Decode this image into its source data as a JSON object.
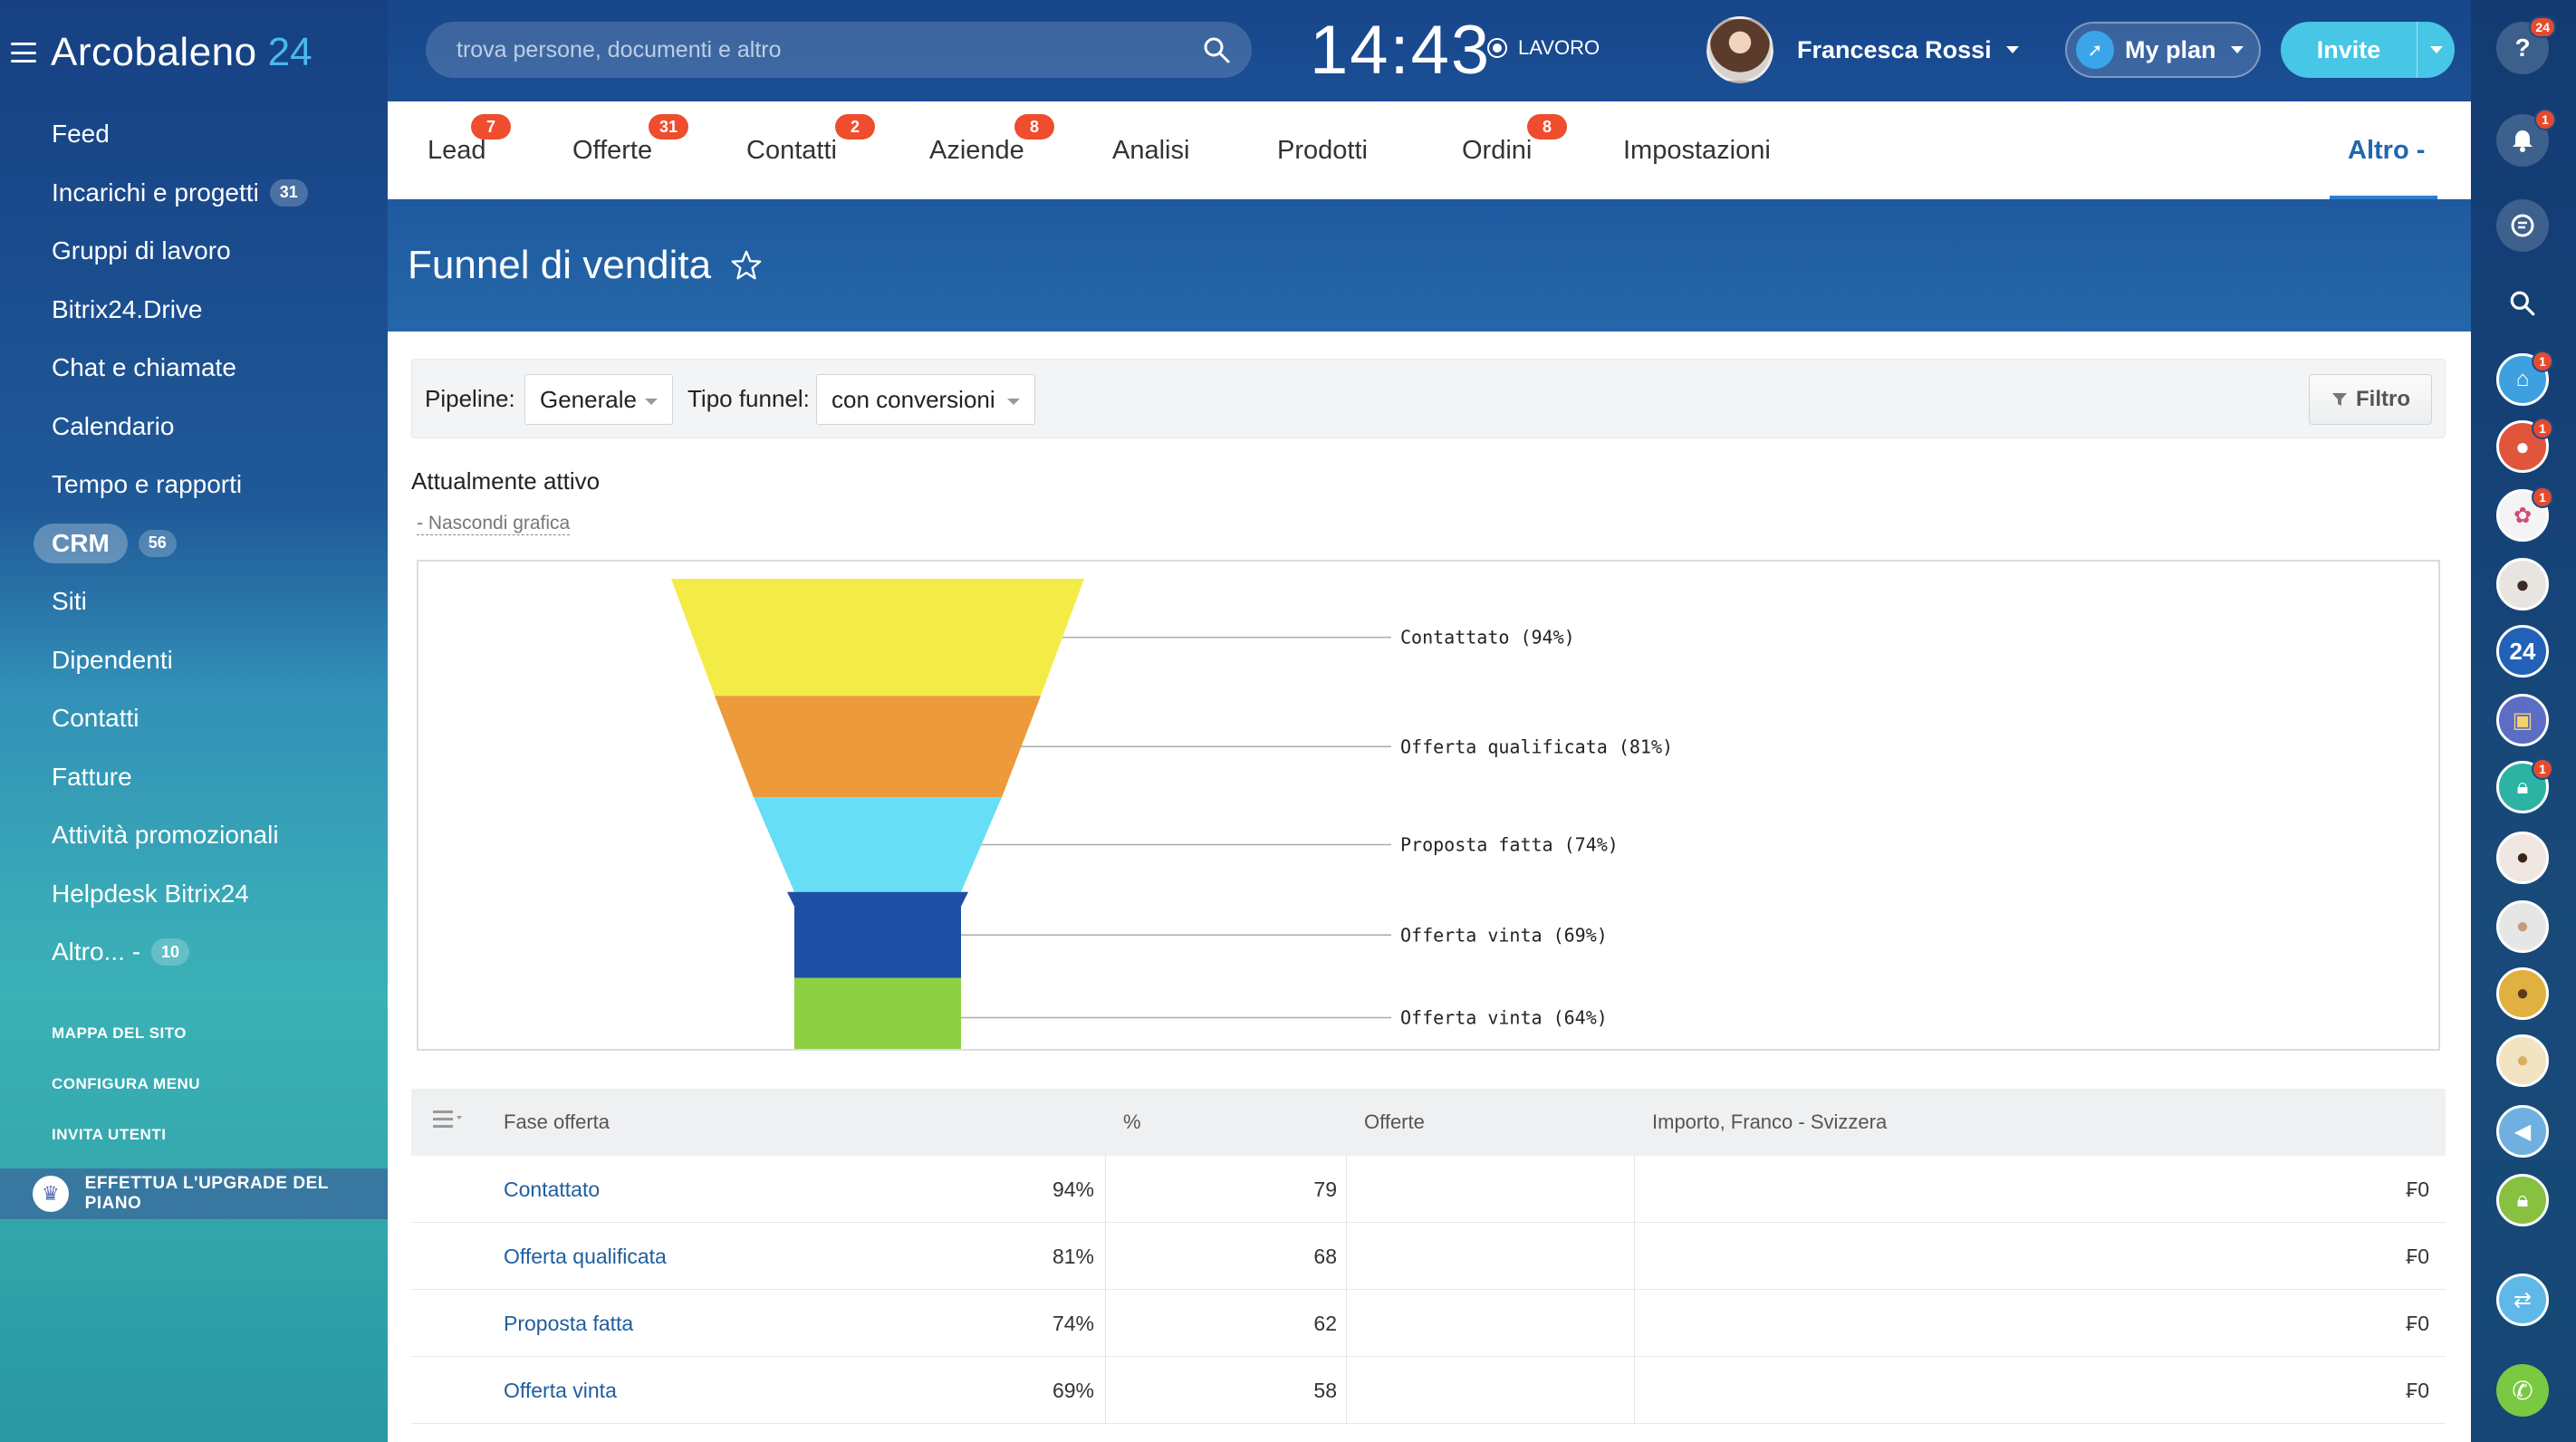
{
  "app": {
    "name": "Arcobaleno",
    "number": "24"
  },
  "sidebar": {
    "items": [
      {
        "label": "Feed",
        "count": ""
      },
      {
        "label": "Incarichi e progetti",
        "count": "31"
      },
      {
        "label": "Gruppi di lavoro",
        "count": ""
      },
      {
        "label": "Bitrix24.Drive",
        "count": ""
      },
      {
        "label": "Chat e chiamate",
        "count": ""
      },
      {
        "label": "Calendario",
        "count": ""
      },
      {
        "label": "Tempo e rapporti",
        "count": ""
      },
      {
        "label": "CRM",
        "count": "56"
      },
      {
        "label": "Siti",
        "count": ""
      },
      {
        "label": "Dipendenti",
        "count": ""
      },
      {
        "label": "Contatti",
        "count": ""
      },
      {
        "label": "Fatture",
        "count": ""
      },
      {
        "label": "Attività promozionali",
        "count": ""
      },
      {
        "label": "Helpdesk Bitrix24",
        "count": ""
      },
      {
        "label": "Altro... -",
        "count": "10"
      }
    ],
    "site_map": "MAPPA DEL SITO",
    "configure_menu": "CONFIGURA MENU",
    "invite_users": "INVITA UTENTI",
    "upgrade": "EFFETTUA L'UPGRADE DEL PIANO"
  },
  "header": {
    "search_placeholder": "trova persone, documenti e altro",
    "clock": "14:43",
    "work_status": "LAVORO",
    "user_name": "Francesca Rossi",
    "my_plan": "My plan",
    "invite": "Invite"
  },
  "rail": {
    "help_badge": "24",
    "notif_badge": "1",
    "apps_badge_1": "1",
    "apps_badge_2": "1",
    "apps_badge_3": "1",
    "apps_badge_4": "1",
    "brand_24": "24"
  },
  "tabs": [
    {
      "label": "Lead",
      "badge": "7"
    },
    {
      "label": "Offerte",
      "badge": "31"
    },
    {
      "label": "Contatti",
      "badge": "2"
    },
    {
      "label": "Aziende",
      "badge": "8"
    },
    {
      "label": "Analisi",
      "badge": ""
    },
    {
      "label": "Prodotti",
      "badge": ""
    },
    {
      "label": "Ordini",
      "badge": "8"
    },
    {
      "label": "Impostazioni",
      "badge": ""
    },
    {
      "label": "Altro -",
      "badge": ""
    }
  ],
  "page": {
    "title": "Funnel di vendita",
    "pipeline_label": "Pipeline:",
    "pipeline_value": "Generale",
    "funnel_type_label": "Tipo funnel:",
    "funnel_type_value": "con conversioni",
    "filter_button": "Filtro",
    "active_label": "Attualmente attivo",
    "hide_chart": "- Nascondi grafica"
  },
  "chart_data": {
    "type": "funnel",
    "stages": [
      {
        "label": "Contattato (94%)",
        "value": 94,
        "color": "#f4ec46"
      },
      {
        "label": "Offerta qualificata (81%)",
        "value": 81,
        "color": "#ec9a3a"
      },
      {
        "label": "Proposta fatta (74%)",
        "value": 74,
        "color": "#66def6"
      },
      {
        "label": "Offerta vinta (69%)",
        "value": 69,
        "color": "#1f4fa5"
      },
      {
        "label": "Offerta vinta (64%)",
        "value": 64,
        "color": "#8dd142"
      }
    ]
  },
  "table": {
    "headers": [
      "Fase offerta",
      "%",
      "Offerte",
      "Importo, Franco - Svizzera"
    ],
    "rows": [
      {
        "stage": "Contattato",
        "pct": "94%",
        "deals": "79",
        "amount": "₣0"
      },
      {
        "stage": "Offerta qualificata",
        "pct": "81%",
        "deals": "68",
        "amount": "₣0"
      },
      {
        "stage": "Proposta fatta",
        "pct": "74%",
        "deals": "62",
        "amount": "₣0"
      },
      {
        "stage": "Offerta vinta",
        "pct": "69%",
        "deals": "58",
        "amount": "₣0"
      }
    ]
  }
}
